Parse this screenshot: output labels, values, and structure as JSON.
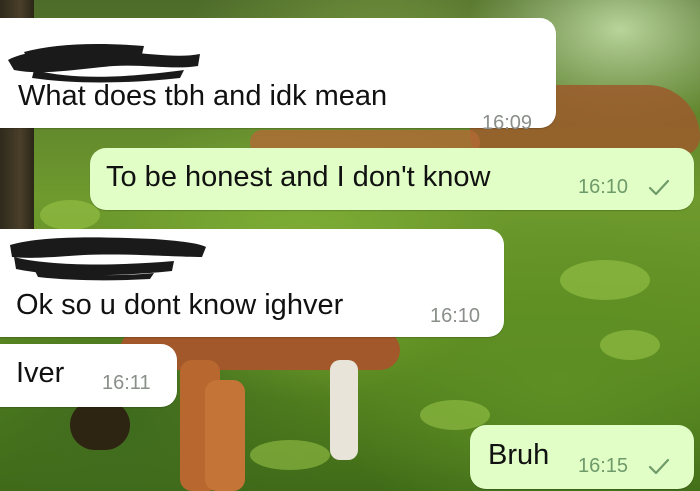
{
  "conversation": {
    "messages": [
      {
        "direction": "incoming",
        "sender_redacted": true,
        "text": "What does tbh and idk mean",
        "time": "16:09"
      },
      {
        "direction": "outgoing",
        "text": "To be honest and I don't know",
        "time": "16:10",
        "status_icon": "single-check-icon"
      },
      {
        "direction": "incoming",
        "sender_redacted": true,
        "text": "Ok so u dont know ighver",
        "time": "16:10"
      },
      {
        "direction": "incoming",
        "text": "Iver",
        "time": "16:11"
      },
      {
        "direction": "outgoing",
        "text": "Bruh",
        "time": "16:15",
        "status_icon": "single-check-icon"
      }
    ]
  },
  "theme": {
    "incoming_bubble": "#ffffff",
    "outgoing_bubble": "#e1fec6",
    "check_color": "#6f9a6a",
    "redaction_color": "#1a1a1a"
  }
}
